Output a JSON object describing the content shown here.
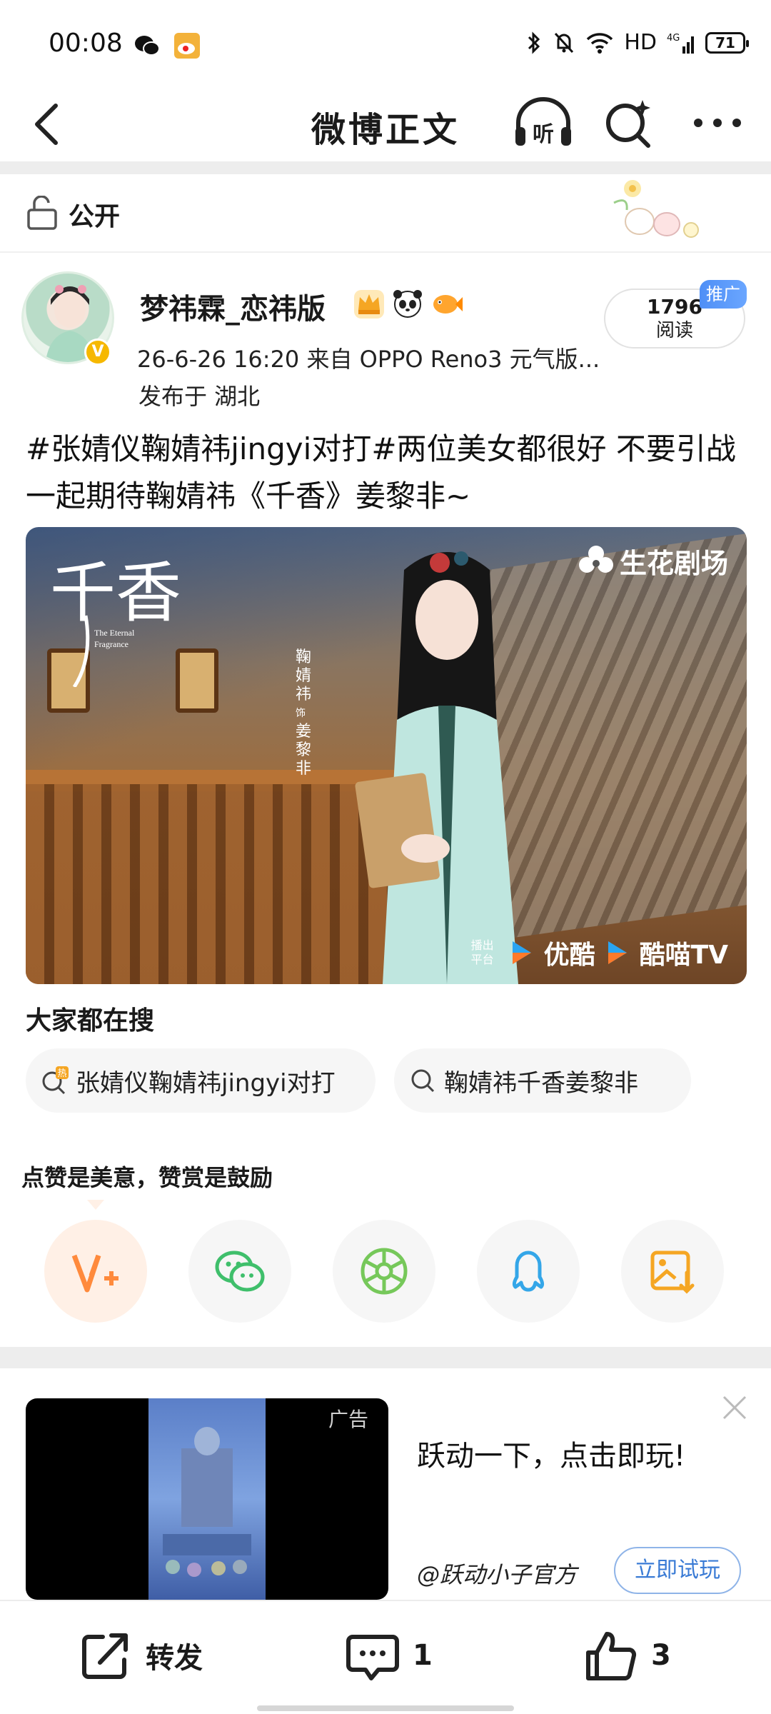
{
  "status_bar": {
    "time": "00:08",
    "network": "HD",
    "cellular": "4G",
    "battery": "71"
  },
  "nav": {
    "title": "微博正文",
    "listen_label": "听"
  },
  "visibility": {
    "label": "公开"
  },
  "post": {
    "username": "梦祎霖_恋祎版",
    "meta": "26-6-26 16:20  来自 OPPO Reno3 元气版...",
    "location": "发布于 湖北",
    "read_count": "1796",
    "read_label": "阅读",
    "promo_tag": "推广",
    "text": "#张婧仪鞠婧祎jingyi对打#两位美女都很好 不要引战 一起期待鞠婧祎《千香》姜黎非~"
  },
  "image": {
    "title_art": "千香",
    "subtitle_line1": "The Eternal",
    "subtitle_line2": "Fragrance",
    "vertical_name": "鞠婧祎",
    "vertical_role_prefix": "饰",
    "vertical_role": "姜黎非",
    "brand": "生花剧场",
    "broadcast": "播出平台",
    "platform1": "优酷",
    "platform2": "酷喵TV"
  },
  "hot_search": {
    "title": "大家都在搜",
    "chips": [
      {
        "label": "张婧仪鞠婧祎jingyi对打",
        "hot_label": "热"
      },
      {
        "label": "鞠婧祎千香姜黎非"
      }
    ]
  },
  "reward": {
    "title": "点赞是美意，赞赏是鼓励",
    "buttons": [
      "vip-icon",
      "wechat-icon",
      "moments-icon",
      "qq-icon",
      "save-image-icon"
    ]
  },
  "ad": {
    "tag": "广告",
    "headline": "跃动一下，点击即玩!",
    "source": "@跃动小子官方",
    "cta": "立即试玩"
  },
  "bottom_bar": {
    "repost_label": "转发",
    "comment_count": "1",
    "like_count": "3"
  },
  "colors": {
    "accent_orange": "#f5a623",
    "vip_orange": "#ff8a3c",
    "wechat_green": "#3fbf6b",
    "qq_blue": "#34a6e8",
    "link_blue": "#3a7bd5",
    "promo_blue": "#4f8ff6"
  }
}
